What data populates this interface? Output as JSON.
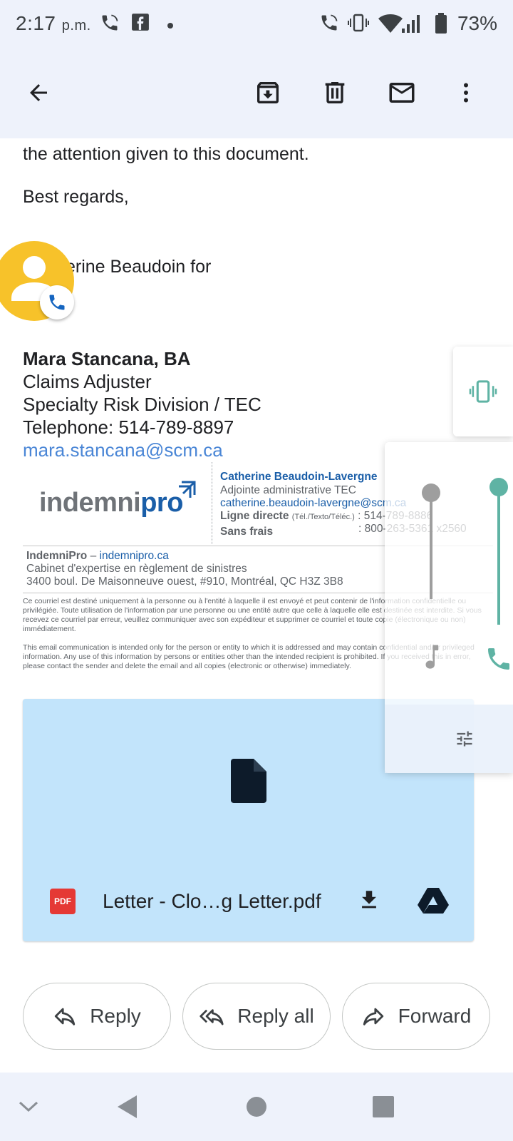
{
  "status_bar": {
    "time": "2:17",
    "period": "p.m.",
    "battery_percent": "73%",
    "icons": [
      "wifi-call-icon",
      "facebook-icon",
      "dot-icon",
      "wifi-call-icon",
      "vibrate-icon",
      "wifi-icon",
      "signal-icon",
      "battery-icon"
    ]
  },
  "toolbar": {
    "icons": [
      "back-arrow-icon",
      "archive-icon",
      "delete-icon",
      "mark-unread-icon",
      "more-vert-icon"
    ]
  },
  "email": {
    "body_line": "the attention given to this document.",
    "closing": "Best regards,",
    "sender_line": "erine Beaudoin for",
    "signature": {
      "name": "Mara Stancana, BA",
      "title": "Claims Adjuster",
      "division": "Specialty Risk Division / TEC",
      "telephone": "Telephone: 514-789-8897",
      "email": "mara.stancana@scm.ca"
    },
    "company_signature": {
      "logo_part1": "indemni",
      "logo_part2": "pro",
      "contact_name": "Catherine Beaudoin-Lavergne",
      "contact_title": "Adjointe administrative TEC",
      "contact_email": "catherine.beaudoin-lavergne@scm.ca",
      "direct_label": "Ligne directe",
      "direct_sub": "(Tél./Texto/Téléc.)",
      "direct_value": ": 514-789-8886",
      "tollfree_label": "Sans frais",
      "tollfree_value": ": 800-263-5361 x2560",
      "company_name": "IndemniPro",
      "company_dash": " – ",
      "company_site": "indemnipro.ca",
      "company_desc": "Cabinet d'expertise en règlement de sinistres",
      "company_address": "3400 boul. De Maisonneuve ouest, #910, Montréal, QC H3Z 3B8"
    },
    "disclaimer_fr": "Ce courriel est destiné uniquement à la personne ou à l'entité à laquelle il est envoyé et peut contenir de l'information confidentielle ou privilégiée. Toute utilisation de l'information par une personne ou une entité autre que celle à laquelle elle est destinée est interdite. Si vous recevez ce courriel par erreur, veuillez communiquer avec son expéditeur et supprimer ce courriel et toute copie (électronique ou non) immédiatement.",
    "disclaimer_en": "This email communication is intended only for the person or entity to which it is addressed and may contain confidential and/or privileged information. Any use of this information by persons or entities other than the intended recipient is prohibited. If you received this in error, please contact the sender and delete the email and all copies (electronic or otherwise) immediately."
  },
  "attachment": {
    "badge": "PDF",
    "filename": "Letter - Clo…g Letter.pdf"
  },
  "actions": {
    "reply": "Reply",
    "reply_all": "Reply all",
    "forward": "Forward"
  },
  "colors": {
    "toolbar_bg": "#eef2fb",
    "attachment_bg": "#c2e4fb",
    "link": "#4a86d6",
    "brand_blue": "#1a5ea8",
    "volume_accent": "#5fb3a4",
    "call_bubble": "#f7c22a"
  }
}
